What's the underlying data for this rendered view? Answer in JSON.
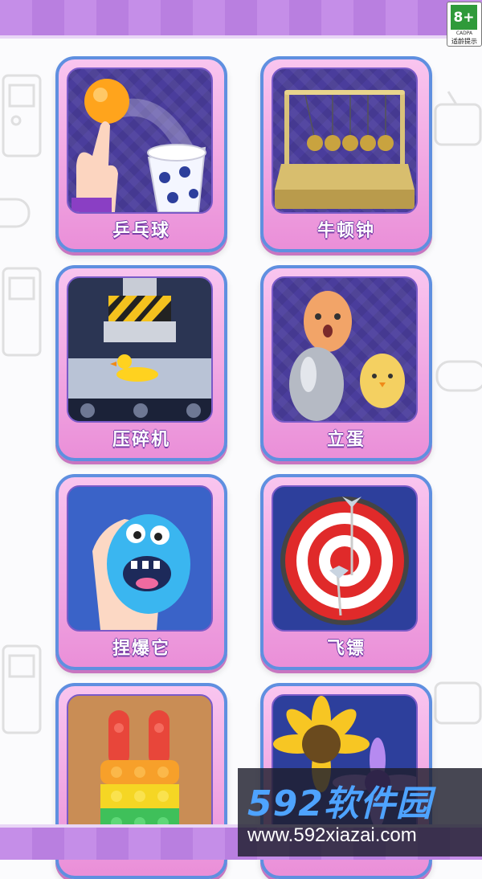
{
  "age_rating": {
    "rating": "8+",
    "org": "CADPA",
    "tip": "适龄提示"
  },
  "games": [
    {
      "label": "乒乓球",
      "icon": "ping-pong-icon"
    },
    {
      "label": "牛顿钟",
      "icon": "newtons-cradle-icon"
    },
    {
      "label": "压碎机",
      "icon": "hydraulic-press-icon"
    },
    {
      "label": "立蛋",
      "icon": "standing-egg-icon"
    },
    {
      "label": "捏爆它",
      "icon": "squeeze-toy-icon"
    },
    {
      "label": "飞镖",
      "icon": "dartboard-icon"
    },
    {
      "label": "",
      "icon": "pop-it-bunny-icon"
    },
    {
      "label": "",
      "icon": "flower-icon"
    }
  ],
  "watermark": {
    "brand": "592软件园",
    "url": "www.592xiazai.com"
  },
  "colors": {
    "strip": "#c58ee8",
    "card": "#f2a9e4",
    "card_border": "#5f8fe0",
    "label_shadow": "#7a3fa8"
  }
}
